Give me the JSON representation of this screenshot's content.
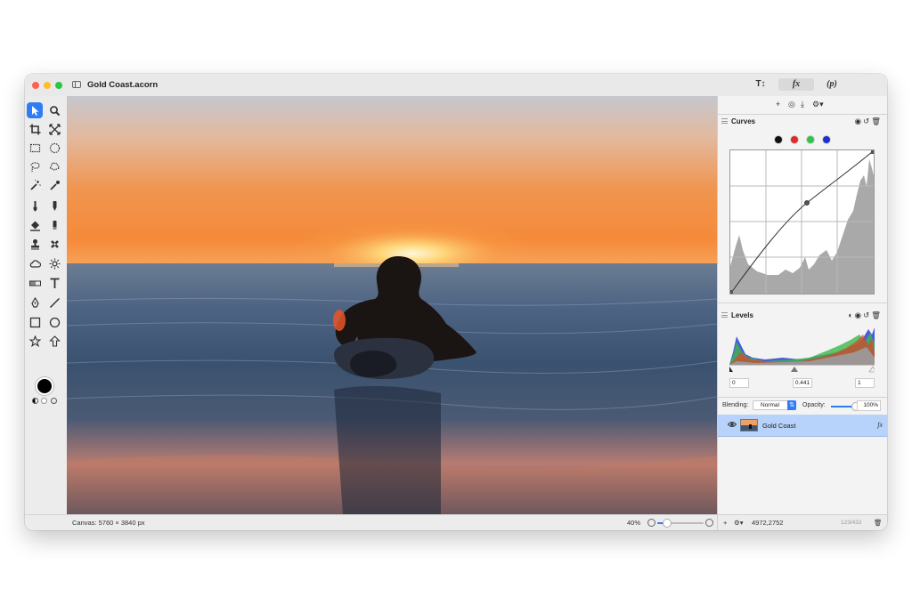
{
  "window": {
    "title": "Gold Coast.acorn"
  },
  "toolbar": {
    "text_tool_icon": "text-size-icon",
    "fx_label": "fx",
    "p_label": "(p)"
  },
  "toolbox": {
    "tools": [
      {
        "name": "select-arrow-icon",
        "active": true
      },
      {
        "name": "zoom-icon"
      },
      {
        "name": "crop-icon"
      },
      {
        "name": "transform-icon"
      },
      {
        "name": "rect-select-icon"
      },
      {
        "name": "ellipse-select-icon"
      },
      {
        "name": "lasso-icon"
      },
      {
        "name": "polygon-lasso-icon"
      },
      {
        "name": "magic-wand-icon"
      },
      {
        "name": "color-wand-icon"
      },
      {
        "name": "brush-icon"
      },
      {
        "name": "marker-icon"
      },
      {
        "name": "fill-bucket-icon"
      },
      {
        "name": "eraser-icon"
      },
      {
        "name": "clone-stamp-icon"
      },
      {
        "name": "healing-icon"
      },
      {
        "name": "cloud-icon"
      },
      {
        "name": "sun-icon"
      },
      {
        "name": "gradient-icon"
      },
      {
        "name": "text-icon"
      },
      {
        "name": "pen-icon"
      },
      {
        "name": "line-icon"
      },
      {
        "name": "rectangle-shape-icon"
      },
      {
        "name": "oval-shape-icon"
      },
      {
        "name": "star-shape-icon"
      },
      {
        "name": "arrow-shape-icon"
      }
    ],
    "foreground_color": "#000000"
  },
  "status": {
    "canvas_info": "Canvas: 5760 × 3840 px",
    "zoom_level": "40%",
    "zoom_fraction": 0.22
  },
  "inspector": {
    "curves": {
      "title": "Curves",
      "channels": [
        {
          "name": "rgb",
          "color": "#111111"
        },
        {
          "name": "red",
          "color": "#e02a2a"
        },
        {
          "name": "green",
          "color": "#2ec44a"
        },
        {
          "name": "blue",
          "color": "#1f2fd1"
        }
      ]
    },
    "levels": {
      "title": "Levels",
      "black_point": "0",
      "gamma": "0.441",
      "white_point": "1"
    },
    "blending": {
      "label": "Blending:",
      "mode": "Normal",
      "opacity_label": "Opacity:",
      "opacity_value": "100%",
      "opacity_fraction": 1.0
    },
    "layers": [
      {
        "name": "Gold Coast",
        "fx": "fx",
        "visible": true
      }
    ],
    "status": {
      "coordinates": "4972,2752",
      "faint": "123/432"
    }
  },
  "colors": {
    "accent": "#2f7df6",
    "selection": "#b8d3fb"
  }
}
